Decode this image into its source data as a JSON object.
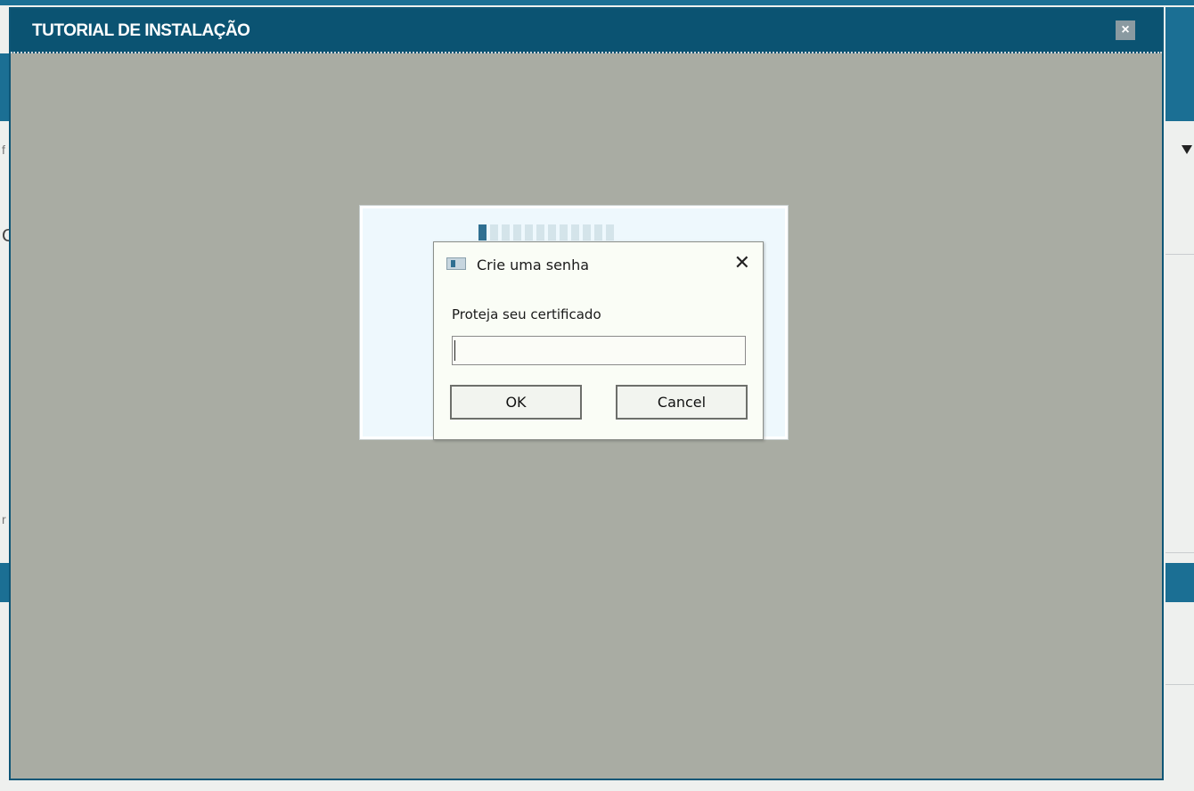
{
  "modal": {
    "title": "TUTORIAL DE INSTALAÇÃO",
    "close_icon": "×"
  },
  "tutorial": {
    "progress": {
      "current_step": 1,
      "total_steps": 12
    }
  },
  "dialog": {
    "icon": "certificate-window-icon",
    "title": "Crie uma senha",
    "close_icon": "✕",
    "label": "Proteja seu certificado",
    "password_value": "",
    "ok_label": "OK",
    "cancel_label": "Cancel"
  },
  "background": {
    "glyphs": [
      "f",
      "C",
      "r"
    ]
  },
  "colors": {
    "header": "#0b5372",
    "overlay": "#a9aca3",
    "accent": "#2f6f91"
  }
}
